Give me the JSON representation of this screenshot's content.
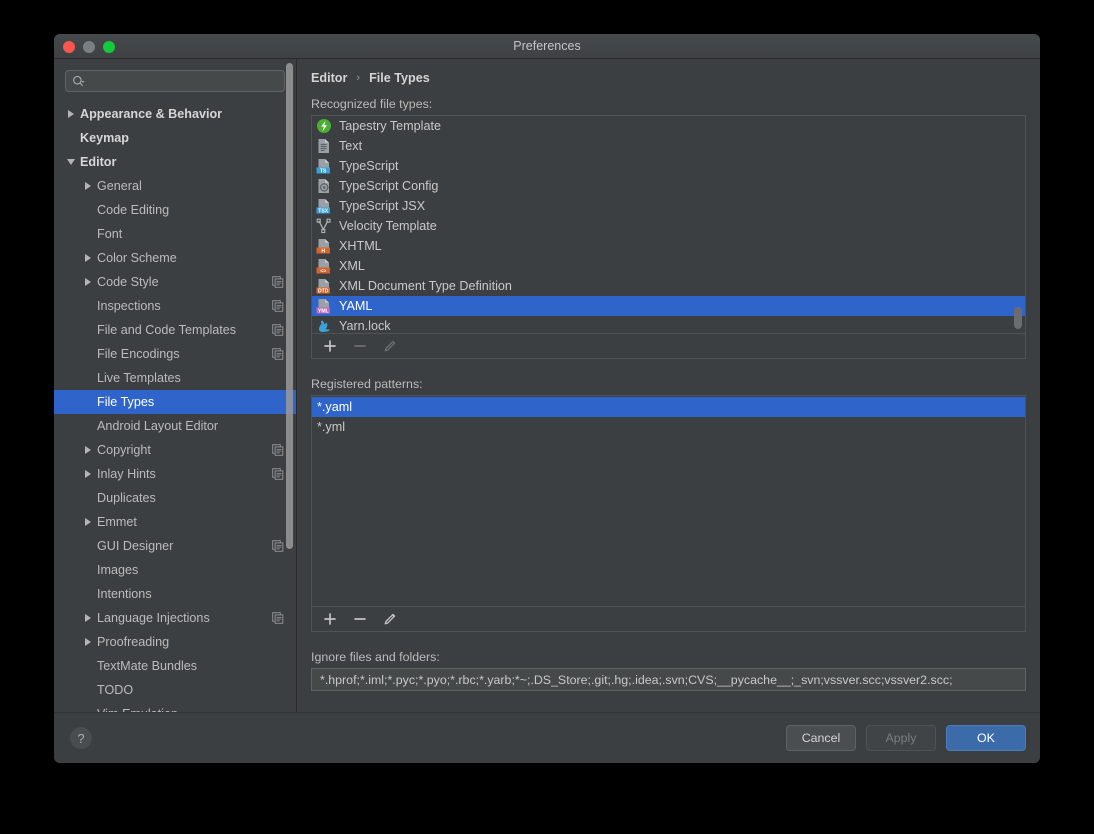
{
  "window": {
    "title": "Preferences",
    "controls": [
      "close",
      "minimize",
      "zoom"
    ]
  },
  "search": {
    "value": "",
    "placeholder": "",
    "icon": "search-icon"
  },
  "sidebar": {
    "items": [
      {
        "label": "Appearance & Behavior",
        "indent": 0,
        "twisty": "right",
        "bold": true,
        "selected": false,
        "copy": false
      },
      {
        "label": "Keymap",
        "indent": 0,
        "twisty": "none",
        "bold": true,
        "selected": false,
        "copy": false
      },
      {
        "label": "Editor",
        "indent": 0,
        "twisty": "down",
        "bold": true,
        "selected": false,
        "copy": false
      },
      {
        "label": "General",
        "indent": 1,
        "twisty": "right",
        "bold": false,
        "selected": false,
        "copy": false
      },
      {
        "label": "Code Editing",
        "indent": 1,
        "twisty": "none",
        "bold": false,
        "selected": false,
        "copy": false
      },
      {
        "label": "Font",
        "indent": 1,
        "twisty": "none",
        "bold": false,
        "selected": false,
        "copy": false
      },
      {
        "label": "Color Scheme",
        "indent": 1,
        "twisty": "right",
        "bold": false,
        "selected": false,
        "copy": false
      },
      {
        "label": "Code Style",
        "indent": 1,
        "twisty": "right",
        "bold": false,
        "selected": false,
        "copy": true
      },
      {
        "label": "Inspections",
        "indent": 1,
        "twisty": "none",
        "bold": false,
        "selected": false,
        "copy": true
      },
      {
        "label": "File and Code Templates",
        "indent": 1,
        "twisty": "none",
        "bold": false,
        "selected": false,
        "copy": true
      },
      {
        "label": "File Encodings",
        "indent": 1,
        "twisty": "none",
        "bold": false,
        "selected": false,
        "copy": true
      },
      {
        "label": "Live Templates",
        "indent": 1,
        "twisty": "none",
        "bold": false,
        "selected": false,
        "copy": false
      },
      {
        "label": "File Types",
        "indent": 1,
        "twisty": "none",
        "bold": false,
        "selected": true,
        "copy": false
      },
      {
        "label": "Android Layout Editor",
        "indent": 1,
        "twisty": "none",
        "bold": false,
        "selected": false,
        "copy": false
      },
      {
        "label": "Copyright",
        "indent": 1,
        "twisty": "right",
        "bold": false,
        "selected": false,
        "copy": true
      },
      {
        "label": "Inlay Hints",
        "indent": 1,
        "twisty": "right",
        "bold": false,
        "selected": false,
        "copy": true
      },
      {
        "label": "Duplicates",
        "indent": 1,
        "twisty": "none",
        "bold": false,
        "selected": false,
        "copy": false
      },
      {
        "label": "Emmet",
        "indent": 1,
        "twisty": "right",
        "bold": false,
        "selected": false,
        "copy": false
      },
      {
        "label": "GUI Designer",
        "indent": 1,
        "twisty": "none",
        "bold": false,
        "selected": false,
        "copy": true
      },
      {
        "label": "Images",
        "indent": 1,
        "twisty": "none",
        "bold": false,
        "selected": false,
        "copy": false
      },
      {
        "label": "Intentions",
        "indent": 1,
        "twisty": "none",
        "bold": false,
        "selected": false,
        "copy": false
      },
      {
        "label": "Language Injections",
        "indent": 1,
        "twisty": "right",
        "bold": false,
        "selected": false,
        "copy": true
      },
      {
        "label": "Proofreading",
        "indent": 1,
        "twisty": "right",
        "bold": false,
        "selected": false,
        "copy": false
      },
      {
        "label": "TextMate Bundles",
        "indent": 1,
        "twisty": "none",
        "bold": false,
        "selected": false,
        "copy": false
      },
      {
        "label": "TODO",
        "indent": 1,
        "twisty": "none",
        "bold": false,
        "selected": false,
        "copy": false
      },
      {
        "label": "Vim Emulation",
        "indent": 1,
        "twisty": "none",
        "bold": false,
        "selected": false,
        "copy": false
      }
    ]
  },
  "breadcrumb": {
    "parent": "Editor",
    "separator": "›",
    "current": "File Types"
  },
  "file_types": {
    "label": "Recognized file types:",
    "rows": [
      {
        "label": "Tapestry Template",
        "icon": "tapestry-icon",
        "selected": false
      },
      {
        "label": "Text",
        "icon": "text-icon",
        "selected": false
      },
      {
        "label": "TypeScript",
        "icon": "ts-icon",
        "selected": false
      },
      {
        "label": "TypeScript Config",
        "icon": "tsconfig-icon",
        "selected": false
      },
      {
        "label": "TypeScript JSX",
        "icon": "tsx-icon",
        "selected": false
      },
      {
        "label": "Velocity Template",
        "icon": "velocity-icon",
        "selected": false
      },
      {
        "label": "XHTML",
        "icon": "xhtml-icon",
        "selected": false
      },
      {
        "label": "XML",
        "icon": "xml-icon",
        "selected": false
      },
      {
        "label": "XML Document Type Definition",
        "icon": "dtd-icon",
        "selected": false
      },
      {
        "label": "YAML",
        "icon": "yaml-icon",
        "selected": true
      },
      {
        "label": "Yarn.lock",
        "icon": "yarn-icon",
        "selected": false
      }
    ],
    "toolbar": {
      "add": "+",
      "remove": "−",
      "edit": "pencil-icon",
      "add_enabled": true,
      "remove_enabled": false,
      "edit_enabled": false
    }
  },
  "patterns": {
    "label": "Registered patterns:",
    "rows": [
      {
        "label": "*.yaml",
        "selected": true
      },
      {
        "label": "*.yml",
        "selected": false
      }
    ],
    "toolbar": {
      "add": "+",
      "remove": "−",
      "edit": "pencil-icon",
      "add_enabled": true,
      "remove_enabled": true,
      "edit_enabled": true
    }
  },
  "ignore": {
    "label": "Ignore files and folders:",
    "value": "*.hprof;*.iml;*.pyc;*.pyo;*.rbc;*.yarb;*~;.DS_Store;.git;.hg;.idea;.svn;CVS;__pycache__;_svn;vssver.scc;vssver2.scc;",
    "placeholder": ""
  },
  "footer": {
    "help": "?",
    "cancel": "Cancel",
    "apply": "Apply",
    "ok": "OK",
    "apply_enabled": false
  },
  "colors": {
    "accent": "#2f65ca",
    "window_bg": "#3c3f41",
    "titlebar": "#45484a",
    "border": "#4f5355",
    "text": "#c9c9c9",
    "primary_button": "#3b6ba8"
  }
}
